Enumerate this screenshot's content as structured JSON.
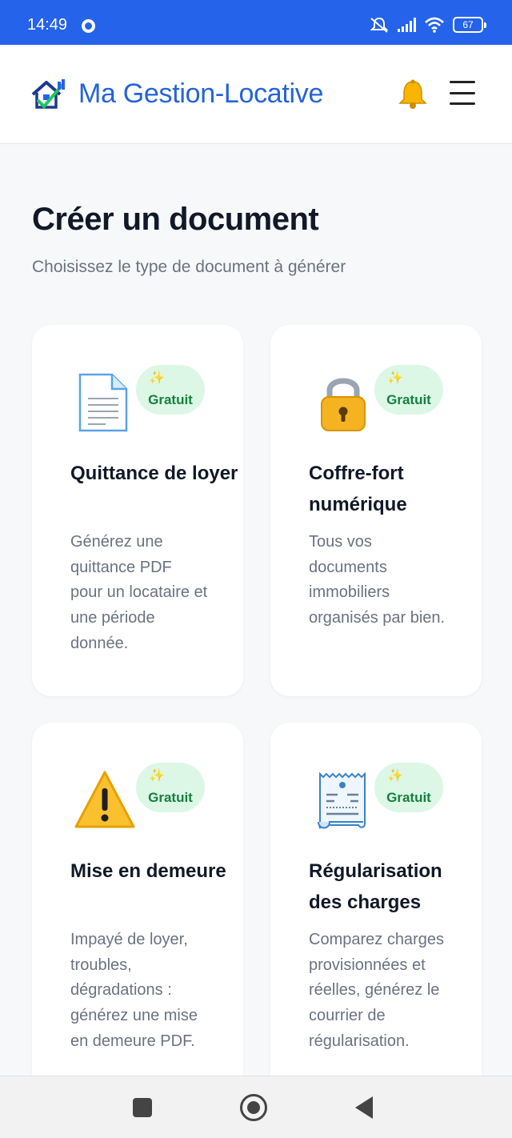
{
  "status_bar": {
    "time": "14:49",
    "battery": "67"
  },
  "header": {
    "app_title": "Ma Gestion-Locative",
    "logo_icon": "house-chart-logo-icon",
    "bell_icon": "bell-icon",
    "menu_icon": "hamburger-menu-icon"
  },
  "page": {
    "title": "Créer un document",
    "subtitle": "Choisissez le type de document à générer"
  },
  "cards": [
    {
      "icon": "document-icon",
      "badge_spark": "✨",
      "badge": "Gratuit",
      "title": "Quittance de loyer",
      "description": "Générez une quittance PDF pour un locataire et une période donnée."
    },
    {
      "icon": "padlock-icon",
      "badge_spark": "✨",
      "badge": "Gratuit",
      "title": "Coffre-fort numérique",
      "description": "Tous vos documents immobiliers organisés par bien."
    },
    {
      "icon": "warning-icon",
      "badge_spark": "✨",
      "badge": "Gratuit",
      "title": "Mise en demeure",
      "description": "Impayé de loyer, troubles, dégradations : générez une mise en demeure PDF."
    },
    {
      "icon": "receipt-icon",
      "badge_spark": "✨",
      "badge": "Gratuit",
      "title": "Régularisation des charges",
      "description": "Comparez charges provisionnées et réelles, générez le courrier de régularisation."
    }
  ],
  "colors": {
    "status_bar": "#2563eb",
    "brand": "#2563d9",
    "badge_bg": "#dcf7e6",
    "badge_text": "#15803d"
  }
}
